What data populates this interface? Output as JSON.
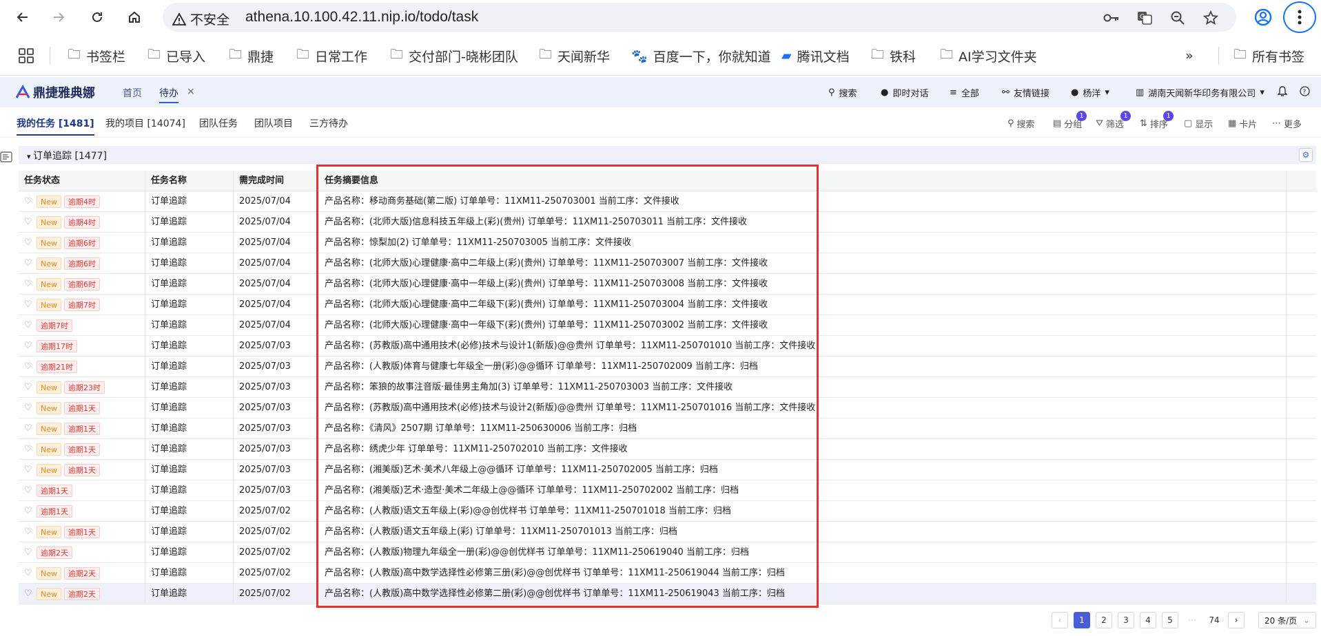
{
  "browser": {
    "security_label": "不安全",
    "url": "athena.10.100.42.11.nip.io/todo/task",
    "bookmarks": [
      "书签栏",
      "已导入",
      "鼎捷",
      "日常工作",
      "交付部门-晓彬团队",
      "天闻新华",
      "百度一下，你就知道",
      "腾讯文档",
      "铁科",
      "AI学习文件夹"
    ],
    "more_bookmarks": "»",
    "all_bookmarks": "所有书签"
  },
  "app": {
    "logo_text": "鼎捷雅典娜",
    "tabs": [
      "首页",
      "待办"
    ],
    "header_items": {
      "search": "搜索",
      "chat": "即时对话",
      "all": "全部",
      "links": "友情链接",
      "user": "杨洋",
      "company": "湖南天闻新华印务有限公司"
    }
  },
  "subtabs": [
    "我的任务 [1481]",
    "我的项目 [14074]",
    "团队任务",
    "团队项目",
    "三方待办"
  ],
  "tools": {
    "search": "搜索",
    "group": "分组",
    "group_badge": "1",
    "filter": "筛选",
    "filter_badge": "1",
    "sort": "排序",
    "sort_badge": "1",
    "display": "显示",
    "card": "卡片",
    "more": "更多"
  },
  "group": {
    "title": "订单追踪 [1477]"
  },
  "table": {
    "columns": [
      "任务状态",
      "任务名称",
      "需完成时间",
      "任务摘要信息"
    ],
    "rows": [
      {
        "new": "New",
        "late": "逾期4时",
        "name": "订单追踪",
        "date": "2025/07/04",
        "summary": "产品名称：移动商务基础(第二版) 订单单号：11XM11-250703001 当前工序：文件接收"
      },
      {
        "new": "New",
        "late": "逾期4时",
        "name": "订单追踪",
        "date": "2025/07/04",
        "summary": "产品名称：(北师大版)信息科技五年级上(彩)(贵州) 订单单号：11XM11-250703011 当前工序：文件接收"
      },
      {
        "new": "New",
        "late": "逾期6时",
        "name": "订单追踪",
        "date": "2025/07/04",
        "summary": "产品名称：惊梨加(2) 订单单号：11XM11-250703005 当前工序：文件接收"
      },
      {
        "new": "New",
        "late": "逾期6时",
        "name": "订单追踪",
        "date": "2025/07/04",
        "summary": "产品名称：(北师大版)心理健康·高中二年级上(彩)(贵州) 订单单号：11XM11-250703007 当前工序：文件接收"
      },
      {
        "new": "New",
        "late": "逾期6时",
        "name": "订单追踪",
        "date": "2025/07/04",
        "summary": "产品名称：(北师大版)心理健康·高中一年级上(彩)(贵州) 订单单号：11XM11-250703008 当前工序：文件接收"
      },
      {
        "new": "New",
        "late": "逾期7时",
        "name": "订单追踪",
        "date": "2025/07/04",
        "summary": "产品名称：(北师大版)心理健康·高中二年级下(彩)(贵州) 订单单号：11XM11-250703004 当前工序：文件接收"
      },
      {
        "new": "",
        "late": "逾期7时",
        "name": "订单追踪",
        "date": "2025/07/04",
        "summary": "产品名称：(北师大版)心理健康·高中一年级下(彩)(贵州) 订单单号：11XM11-250703002 当前工序：文件接收"
      },
      {
        "new": "",
        "late": "逾期17时",
        "name": "订单追踪",
        "date": "2025/07/03",
        "summary": "产品名称：(苏教版)高中通用技术(必修)技术与设计1(新版)@@贵州 订单单号：11XM11-250701010 当前工序：文件接收"
      },
      {
        "new": "",
        "late": "逾期21时",
        "name": "订单追踪",
        "date": "2025/07/03",
        "summary": "产品名称：(人教版)体育与健康七年级全一册(彩)@@循环 订单单号：11XM11-250702009 当前工序：归档"
      },
      {
        "new": "New",
        "late": "逾期23时",
        "name": "订单追踪",
        "date": "2025/07/03",
        "summary": "产品名称：笨狼的故事注音版·最佳男主角加(3) 订单单号：11XM11-250703003 当前工序：文件接收"
      },
      {
        "new": "New",
        "late": "逾期1天",
        "name": "订单追踪",
        "date": "2025/07/03",
        "summary": "产品名称：(苏教版)高中通用技术(必修)技术与设计2(新版)@@贵州 订单单号：11XM11-250701016 当前工序：文件接收"
      },
      {
        "new": "New",
        "late": "逾期1天",
        "name": "订单追踪",
        "date": "2025/07/03",
        "summary": "产品名称：《清风》2507期 订单单号：11XM11-250630006 当前工序：归档"
      },
      {
        "new": "New",
        "late": "逾期1天",
        "name": "订单追踪",
        "date": "2025/07/03",
        "summary": "产品名称：绣虎少年 订单单号：11XM11-250702010 当前工序：文件接收"
      },
      {
        "new": "New",
        "late": "逾期1天",
        "name": "订单追踪",
        "date": "2025/07/03",
        "summary": "产品名称：(湘美版)艺术·美术八年级上@@循环 订单单号：11XM11-250702005 当前工序：归档"
      },
      {
        "new": "",
        "late": "逾期1天",
        "name": "订单追踪",
        "date": "2025/07/03",
        "summary": "产品名称：(湘美版)艺术·造型·美术二年级上@@循环 订单单号：11XM11-250702002 当前工序：归档"
      },
      {
        "new": "",
        "late": "逾期1天",
        "name": "订单追踪",
        "date": "2025/07/02",
        "summary": "产品名称：(人教版)语文五年级上(彩)@@创优样书 订单单号：11XM11-250701018 当前工序：归档"
      },
      {
        "new": "New",
        "late": "逾期1天",
        "name": "订单追踪",
        "date": "2025/07/02",
        "summary": "产品名称：(人教版)语文五年级上(彩) 订单单号：11XM11-250701013 当前工序：归档"
      },
      {
        "new": "",
        "late": "逾期2天",
        "name": "订单追踪",
        "date": "2025/07/02",
        "summary": "产品名称：(人教版)物理九年级全一册(彩)@@创优样书 订单单号：11XM11-250619040 当前工序：归档"
      },
      {
        "new": "New",
        "late": "逾期2天",
        "name": "订单追踪",
        "date": "2025/07/02",
        "summary": "产品名称：(人教版)高中数学选择性必修第三册(彩)@@创优样书 订单单号：11XM11-250619044 当前工序：归档"
      },
      {
        "new": "New",
        "late": "逾期2天",
        "name": "订单追踪",
        "date": "2025/07/02",
        "summary": "产品名称：(人教版)高中数学选择性必修第二册(彩)@@创优样书 订单单号：11XM11-250619043 当前工序：归档"
      }
    ]
  },
  "pagination": {
    "pages": [
      "1",
      "2",
      "3",
      "4",
      "5"
    ],
    "ellipsis": "···",
    "last": "74",
    "page_size": "20 条/页"
  },
  "colors": {
    "accent": "#4a5dd9",
    "highlight": "#e8312f",
    "late": "#e03a3a",
    "new": "#e88a19"
  }
}
